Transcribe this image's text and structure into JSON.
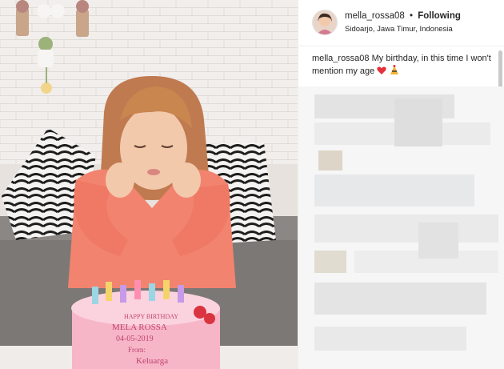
{
  "post": {
    "author": {
      "username": "mella_rossa08",
      "follow_status": "Following",
      "separator": "•",
      "location": "Sidoarjo, Jawa Timur, Indonesia"
    },
    "caption": {
      "username": "mella_rossa08",
      "text": "My birthday, in this time I won't mention my age",
      "emojis": [
        "heart-emoji",
        "party-hat-emoji"
      ]
    },
    "photo": {
      "cake_text": [
        "HAPPY BIRTHDAY",
        "MELA ROSSA",
        "04-05-2019",
        "From:",
        "Keluarga"
      ]
    },
    "colors": {
      "sweater": "#f2836f",
      "cake": "#f7b6c8",
      "wall": "#efecea",
      "text": "#262626"
    }
  }
}
